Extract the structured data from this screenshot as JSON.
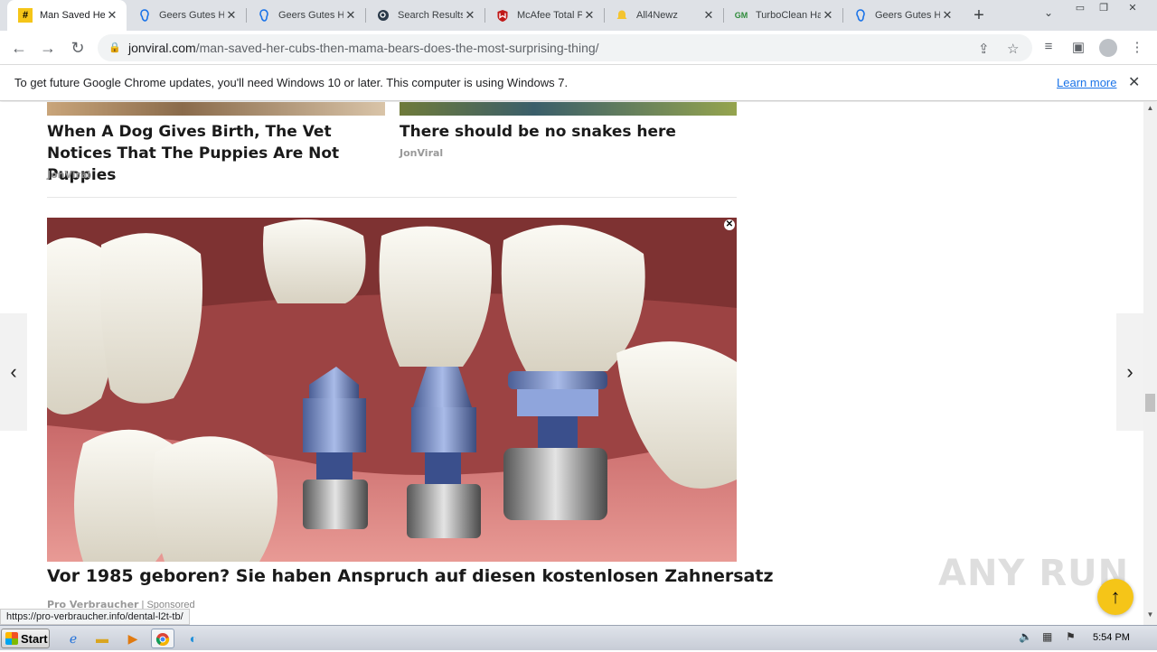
{
  "browser": {
    "tabs": [
      {
        "title": "Man Saved He",
        "favicon": "hash-icon",
        "active": true
      },
      {
        "title": "Geers Gutes H",
        "favicon": "ear-icon"
      },
      {
        "title": "Geers Gutes H",
        "favicon": "ear-icon"
      },
      {
        "title": "Search Results",
        "favicon": "search-result-icon"
      },
      {
        "title": "McAfee Total P",
        "favicon": "mcafee-shield-icon"
      },
      {
        "title": "All4Newz",
        "favicon": "bell-icon"
      },
      {
        "title": "TurboClean Ha",
        "favicon": "gm-icon"
      },
      {
        "title": "Geers Gutes H",
        "favicon": "ear-icon"
      }
    ],
    "favicon_text": {
      "hash": "#",
      "gm": "GM"
    },
    "url_host": "jonviral.com",
    "url_path": "/man-saved-her-cubs-then-mama-bears-does-the-most-surprising-thing/",
    "infobar_message": "To get future Google Chrome updates, you'll need Windows 10 or later. This computer is using Windows 7.",
    "infobar_link": "Learn more",
    "status_url": "https://pro-verbraucher.info/dental-l2t-tb/"
  },
  "page": {
    "cards": [
      {
        "title": "When A Dog Gives Birth, The Vet Notices That The Puppies Are Not Puppies",
        "source": "JonViral"
      },
      {
        "title": "There should be no snakes here",
        "source": "JonViral"
      }
    ],
    "ad": {
      "title": "Vor 1985 geboren? Sie haben Anspruch auf diesen kostenlosen Zahnersatz",
      "source": "Pro Verbraucher",
      "separator": "|",
      "sponsored": "Sponsored"
    },
    "watermark": "ANY RUN"
  },
  "taskbar": {
    "start_label": "Start",
    "clock": "5:54 PM"
  },
  "colors": {
    "accent_link": "#1a73e8",
    "totop_button": "#f5c518",
    "tab_strip": "#dee1e6"
  }
}
